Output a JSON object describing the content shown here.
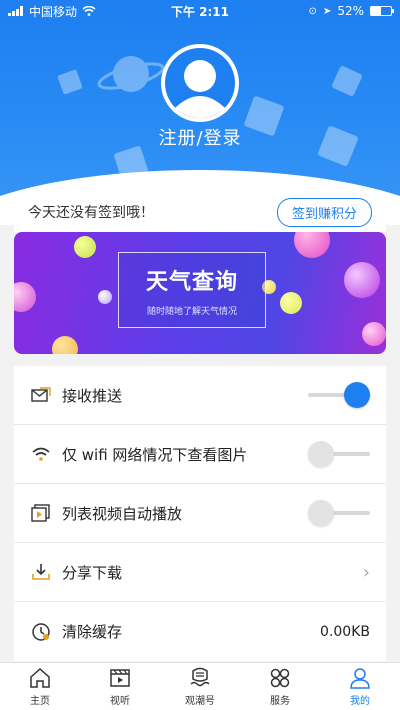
{
  "status_bar": {
    "carrier": "中国移动",
    "time": "下午 2:11",
    "battery": "52%",
    "battery_level": 0.52
  },
  "profile": {
    "login_label": "注册/登录"
  },
  "checkin": {
    "text": "今天还没有签到哦！",
    "button_label": "签到赚积分"
  },
  "banner": {
    "title": "天气查询",
    "subtitle": "随时随地了解天气情况"
  },
  "settings": [
    {
      "label": "接收推送",
      "icon": "envelope-icon",
      "control": "toggle",
      "on": true
    },
    {
      "label": "仅 wifi 网络情况下查看图片",
      "icon": "wifi-icon",
      "control": "toggle",
      "on": false
    },
    {
      "label": "列表视频自动播放",
      "icon": "video-play-icon",
      "control": "toggle",
      "on": false
    },
    {
      "label": "分享下载",
      "icon": "download-icon",
      "control": "chevron"
    },
    {
      "label": "清除缓存",
      "icon": "clear-cache-icon",
      "control": "value",
      "value": "0.00KB"
    }
  ],
  "tabbar": {
    "items": [
      {
        "label": "主页",
        "icon": "home-icon",
        "active": false
      },
      {
        "label": "视听",
        "icon": "film-icon",
        "active": false
      },
      {
        "label": "观潮号",
        "icon": "tide-icon",
        "active": false
      },
      {
        "label": "服务",
        "icon": "grid-icon",
        "active": false
      },
      {
        "label": "我的",
        "icon": "user-icon",
        "active": true
      }
    ]
  },
  "colors": {
    "accent": "#1d7ff0",
    "header": "#2a8cf4",
    "banner_start": "#8a2be2",
    "banner_end": "#4f46e5"
  }
}
